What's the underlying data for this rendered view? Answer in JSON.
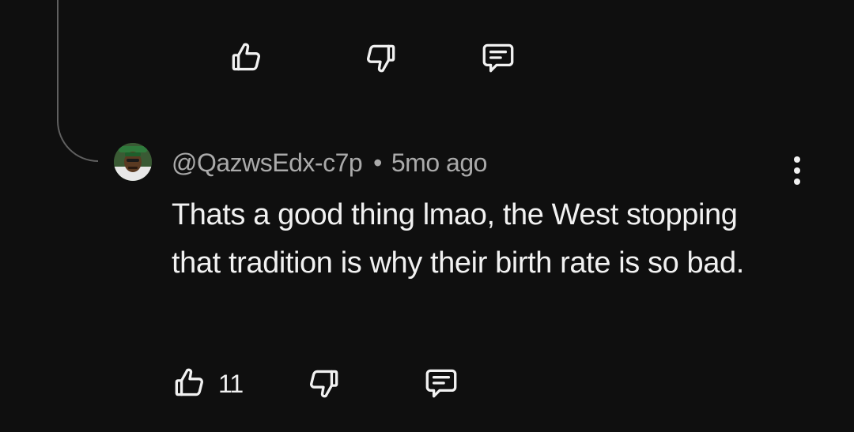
{
  "parent_comment": {
    "actions": {
      "like_icon": "thumbs-up-icon",
      "dislike_icon": "thumbs-down-icon",
      "reply_icon": "comment-icon"
    }
  },
  "reply": {
    "handle": "@QazwsEdx-c7p",
    "separator": "•",
    "time_ago": "5mo ago",
    "text": "Thats a good thing lmao, the West stopping that tradition is why their birth rate is so bad.",
    "like_count": "11",
    "menu_icon": "vertical-dots-icon"
  },
  "colors": {
    "background": "#0f0f0f",
    "text_primary": "#f1f1f1",
    "text_secondary": "#aaaaaa",
    "thread_line": "#606060"
  }
}
